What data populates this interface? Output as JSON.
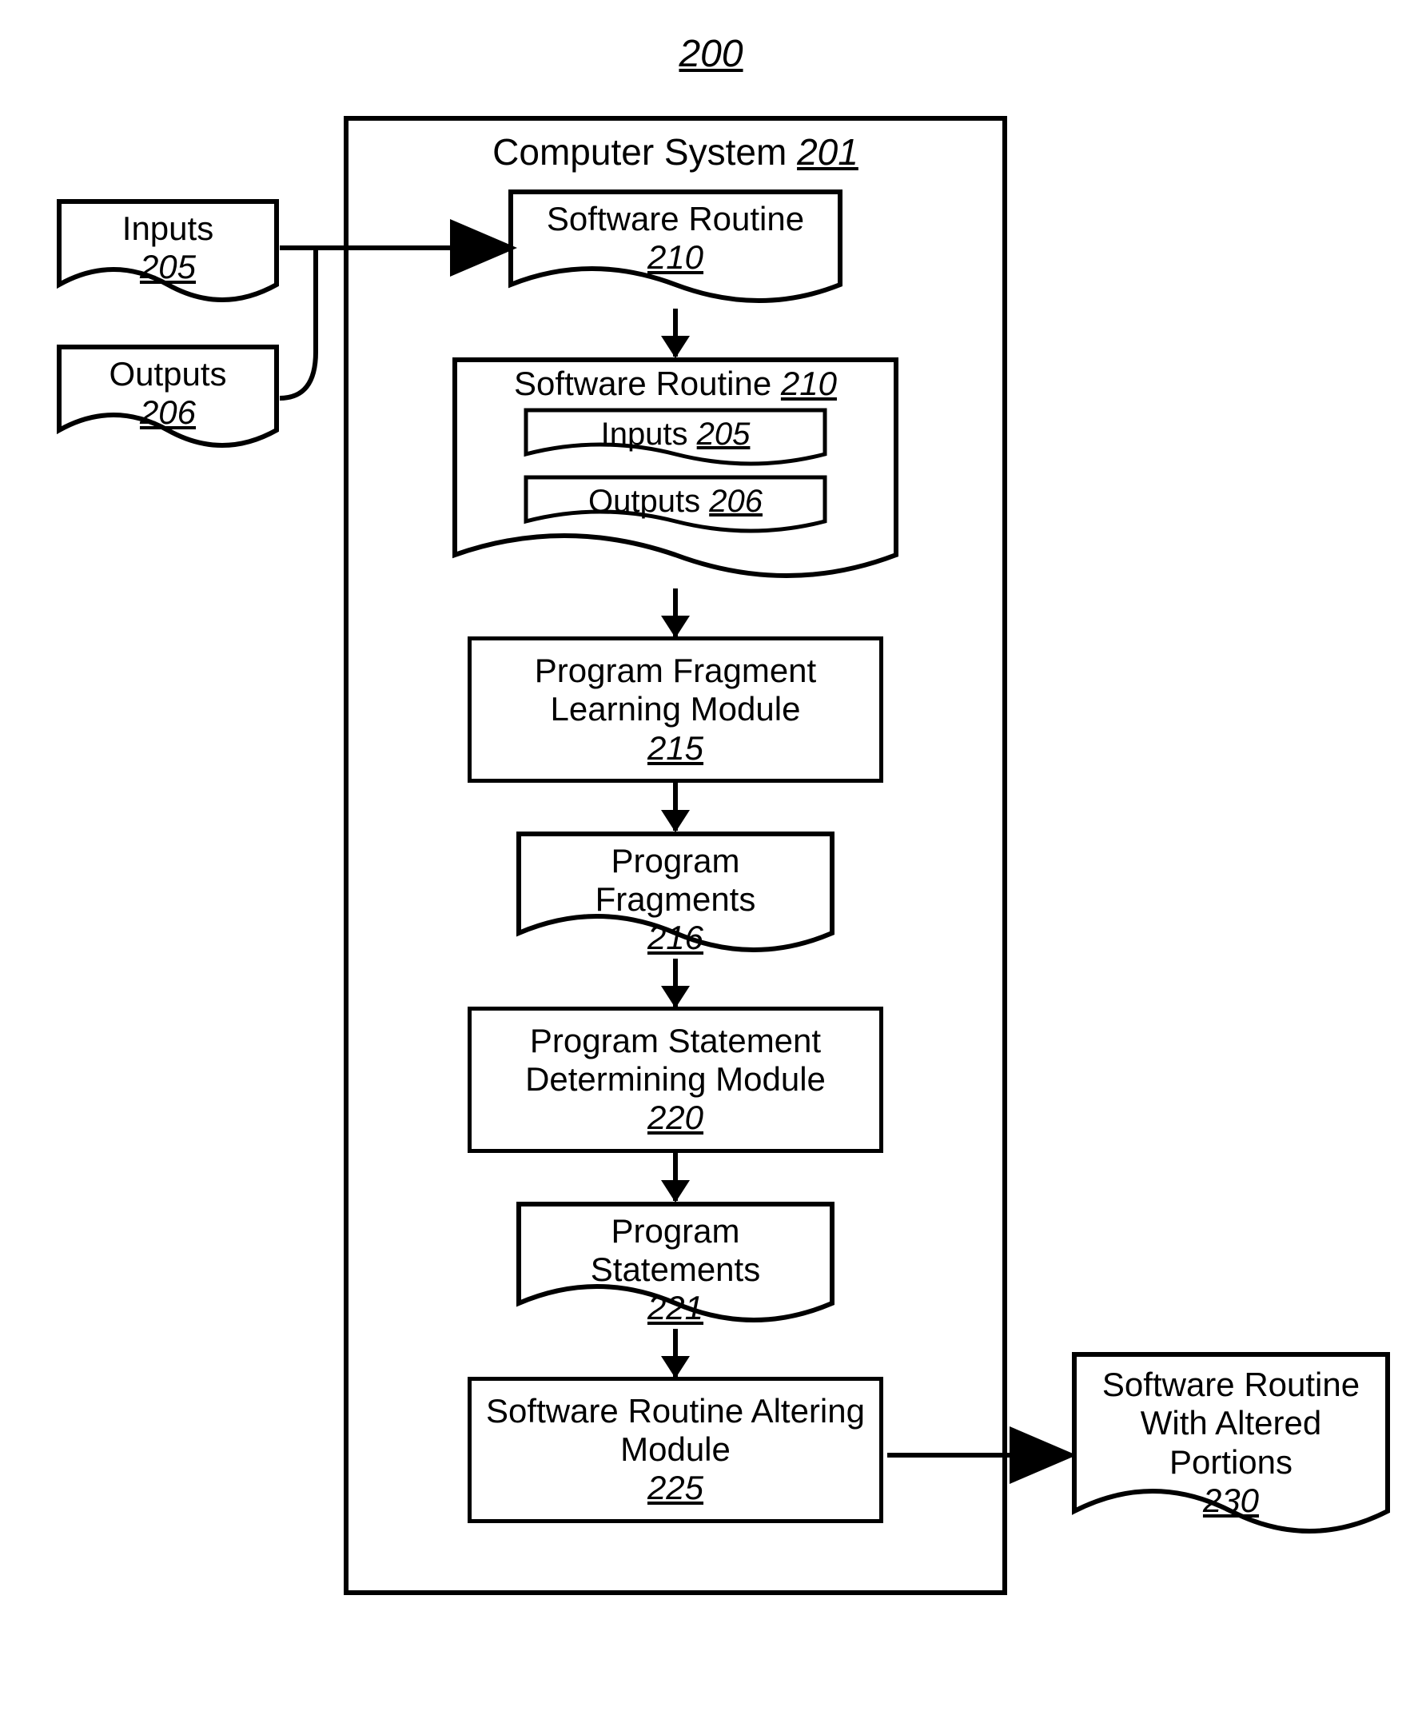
{
  "figure": {
    "number": "200"
  },
  "system": {
    "title": "Computer System",
    "ref": "201"
  },
  "left": {
    "inputs": {
      "label": "Inputs",
      "ref": "205"
    },
    "outputs": {
      "label": "Outputs",
      "ref": "206"
    }
  },
  "flow": {
    "software_routine": {
      "label": "Software Routine",
      "ref": "210"
    },
    "routine_container": {
      "title": "Software Routine",
      "ref": "210",
      "inputs": {
        "label": "Inputs",
        "ref": "205"
      },
      "outputs": {
        "label": "Outputs",
        "ref": "206"
      }
    },
    "fragment_learning": {
      "label": "Program Fragment Learning Module",
      "ref": "215"
    },
    "program_fragments": {
      "label": "Program Fragments",
      "ref": "216"
    },
    "statement_determining": {
      "label": "Program Statement Determining Module",
      "ref": "220"
    },
    "program_statements": {
      "label": "Program Statements",
      "ref": "221"
    },
    "altering_module": {
      "label": "Software Routine Altering Module",
      "ref": "225"
    }
  },
  "output": {
    "label": "Software Routine With Altered Portions",
    "ref": "230"
  }
}
